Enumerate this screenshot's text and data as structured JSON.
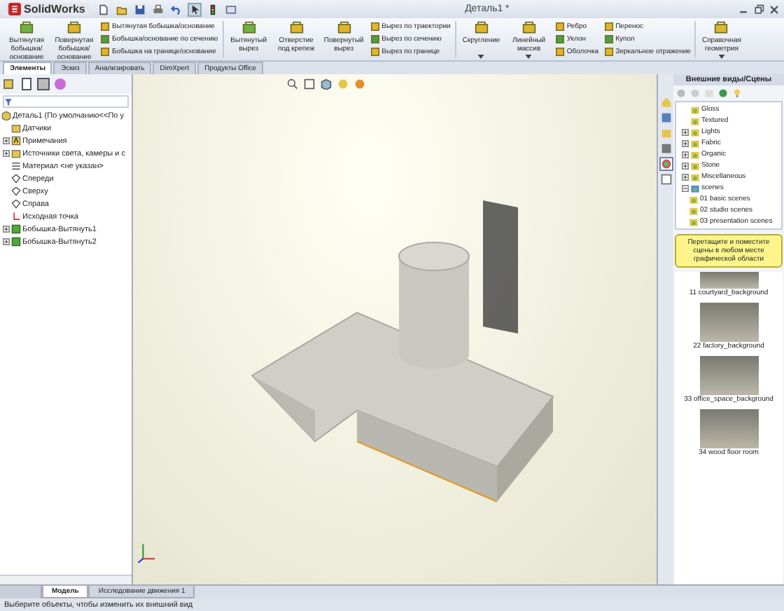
{
  "window": {
    "app": "SolidWorks",
    "title": "Деталь1 *"
  },
  "ribbon": [
    {
      "kind": "large",
      "label": "Вытянутая бобышка/основание"
    },
    {
      "kind": "large",
      "label": "Повернутая бобышка/основание"
    },
    {
      "kind": "stack",
      "items": [
        "Вытянутая бобышка/основание",
        "Бобышка/основание по сечению",
        "Бобышка на границе/основание"
      ]
    },
    {
      "kind": "large",
      "label": "Вытянутый вырез",
      "dropdown": false
    },
    {
      "kind": "large",
      "label": "Отверстие под крепеж",
      "dropdown": false
    },
    {
      "kind": "large",
      "label": "Повернутый вырез",
      "dropdown": false
    },
    {
      "kind": "stack",
      "items": [
        "Вырез по траектории",
        "Вырез по сечению",
        "Вырез по границе"
      ]
    },
    {
      "kind": "large",
      "label": "Скругление",
      "dropdown": true
    },
    {
      "kind": "large",
      "label": "Линейный массив",
      "dropdown": true
    },
    {
      "kind": "stack",
      "items": [
        "Ребро",
        "Уклон",
        "Оболочка"
      ]
    },
    {
      "kind": "stack",
      "items": [
        "Перенос",
        "Купол",
        "Зеркальное отражение"
      ]
    },
    {
      "kind": "large",
      "label": "Справочная геометрия",
      "dropdown": true
    }
  ],
  "command_tabs": [
    {
      "label": "Элементы",
      "selected": true
    },
    {
      "label": "Эскиз",
      "selected": false
    },
    {
      "label": "Анализировать",
      "selected": false
    },
    {
      "label": "DimXpert",
      "selected": false
    },
    {
      "label": "Продукты Office",
      "selected": false
    }
  ],
  "feature_tree": {
    "label": "Деталь1  (По умолчанию<<По у",
    "children": [
      {
        "label": "Датчики"
      },
      {
        "label": "Примечания",
        "expanded": false
      },
      {
        "label": "Источники света, камеры и с",
        "expanded": false
      },
      {
        "label": "Материал <не указан>"
      },
      {
        "label": "Спереди"
      },
      {
        "label": "Сверху"
      },
      {
        "label": "Справа"
      },
      {
        "label": "Исходная точка"
      },
      {
        "label": "Бобышка-Вытянуть1",
        "expanded": false
      },
      {
        "label": "Бобышка-Вытянуть2",
        "expanded": false
      }
    ]
  },
  "appearances_panel": {
    "title": "Внешние виды/Сцены",
    "tree": [
      {
        "label": "Gloss"
      },
      {
        "label": "Textured"
      },
      {
        "label": "Lights",
        "expanded": false
      },
      {
        "label": "Fabric",
        "expanded": false
      },
      {
        "label": "Organic",
        "expanded": false
      },
      {
        "label": "Stone",
        "expanded": false
      },
      {
        "label": "Miscellaneous",
        "expanded": false
      },
      {
        "label": "scenes",
        "expanded": true,
        "children": [
          {
            "label": "01 basic scenes"
          },
          {
            "label": "02 studio scenes"
          },
          {
            "label": "03 presentation scenes"
          }
        ]
      }
    ],
    "hint": "Перетащите и поместите сцены в любом месте графической области",
    "scenes": [
      "11 courtyard_background",
      "22 factory_background",
      "33 office_space_background",
      "34 wood floor room"
    ]
  },
  "bottom_tabs": [
    {
      "label": "Модель",
      "selected": true
    },
    {
      "label": "Исследование движения 1",
      "selected": false
    }
  ],
  "status_bar": "Выберите объекты, чтобы изменить их внешний вид"
}
